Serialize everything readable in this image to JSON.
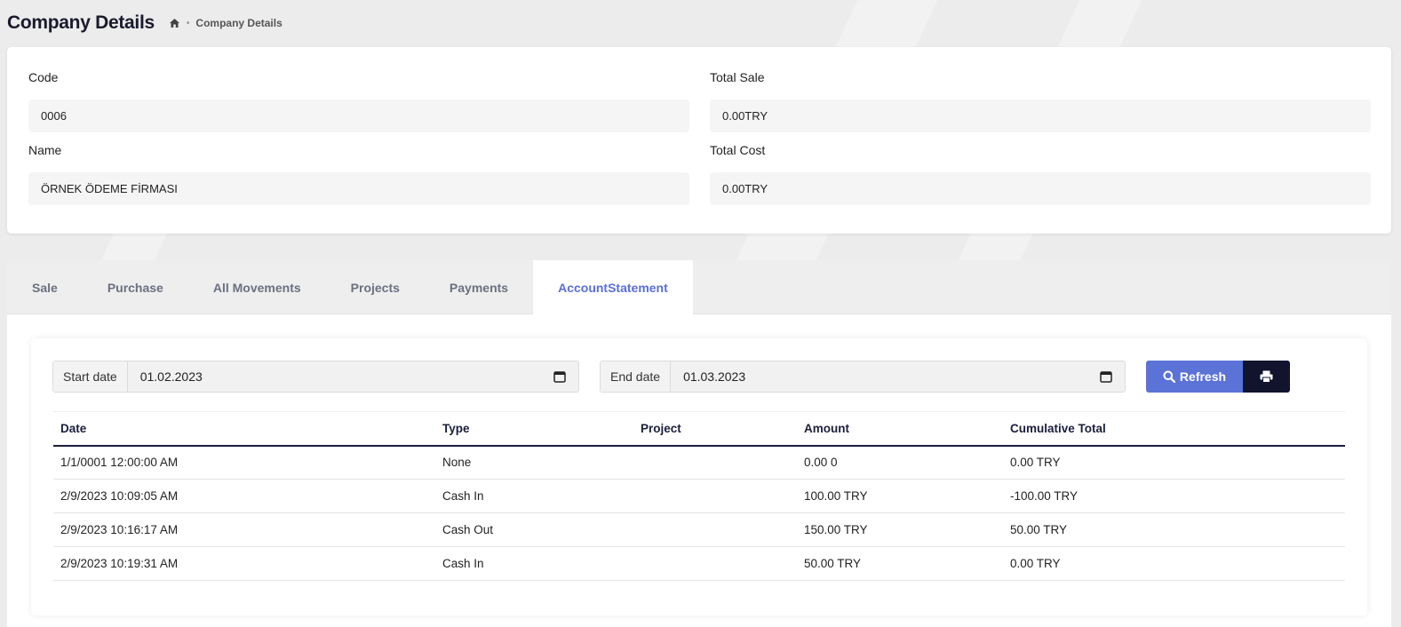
{
  "header": {
    "title": "Company Details",
    "breadcrumb": {
      "home_icon": "home-icon",
      "current": "Company Details"
    }
  },
  "info": {
    "code": {
      "label": "Code",
      "value": "0006"
    },
    "name": {
      "label": "Name",
      "value": "ÖRNEK ÖDEME FİRMASI"
    },
    "total_sale": {
      "label": "Total Sale",
      "value": "0.00TRY"
    },
    "total_cost": {
      "label": "Total Cost",
      "value": "0.00TRY"
    }
  },
  "tabs": [
    {
      "label": "Sale",
      "active": false
    },
    {
      "label": "Purchase",
      "active": false
    },
    {
      "label": "All Movements",
      "active": false
    },
    {
      "label": "Projects",
      "active": false
    },
    {
      "label": "Payments",
      "active": false
    },
    {
      "label": "AccountStatement",
      "active": true
    }
  ],
  "filters": {
    "start_label": "Start date",
    "start_value": "01.02.2023",
    "end_label": "End date",
    "end_value": "01.03.2023",
    "refresh_label": "Refresh",
    "print_icon": "print-icon"
  },
  "table": {
    "columns": [
      "Date",
      "Type",
      "Project",
      "Amount",
      "Cumulative Total"
    ],
    "rows": [
      {
        "date": "1/1/0001 12:00:00 AM",
        "type": "None",
        "type_kind": "none",
        "project": "",
        "amount": "0.00 0",
        "cumulative": "0.00 TRY"
      },
      {
        "date": "2/9/2023 10:09:05 AM",
        "type": "Cash In",
        "type_kind": "in",
        "project": "",
        "amount": "100.00 TRY",
        "cumulative": "-100.00 TRY"
      },
      {
        "date": "2/9/2023 10:16:17 AM",
        "type": "Cash Out",
        "type_kind": "out",
        "project": "",
        "amount": "150.00 TRY",
        "cumulative": "50.00 TRY"
      },
      {
        "date": "2/9/2023 10:19:31 AM",
        "type": "Cash In",
        "type_kind": "in",
        "project": "",
        "amount": "50.00 TRY",
        "cumulative": "0.00 TRY"
      }
    ]
  },
  "colors": {
    "accent": "#5b73d6",
    "dark": "#12142e",
    "cash_in": "#4c8ca4",
    "cash_out": "#d4393f"
  }
}
